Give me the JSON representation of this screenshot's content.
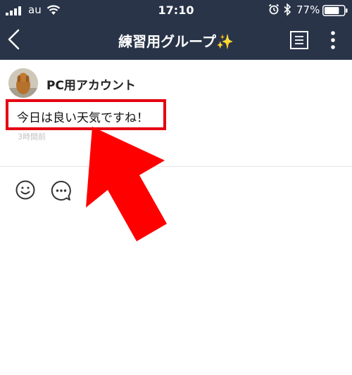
{
  "status_bar": {
    "carrier": "au",
    "time": "17:10",
    "battery_percent": "77%",
    "battery_level": 0.77
  },
  "nav": {
    "title": "練習用グループ✨"
  },
  "post": {
    "author": "PC用アカウント",
    "message": "今日は良い天気ですね！",
    "timestamp": "3時間前"
  },
  "colors": {
    "header_bg": "#293449",
    "highlight": "#e50012"
  },
  "icons": [
    "signal-icon",
    "wifi-icon",
    "alarm-icon",
    "bluetooth-icon",
    "battery-icon",
    "back-icon",
    "notes-icon",
    "more-icon",
    "emoji-icon",
    "reply-icon"
  ]
}
